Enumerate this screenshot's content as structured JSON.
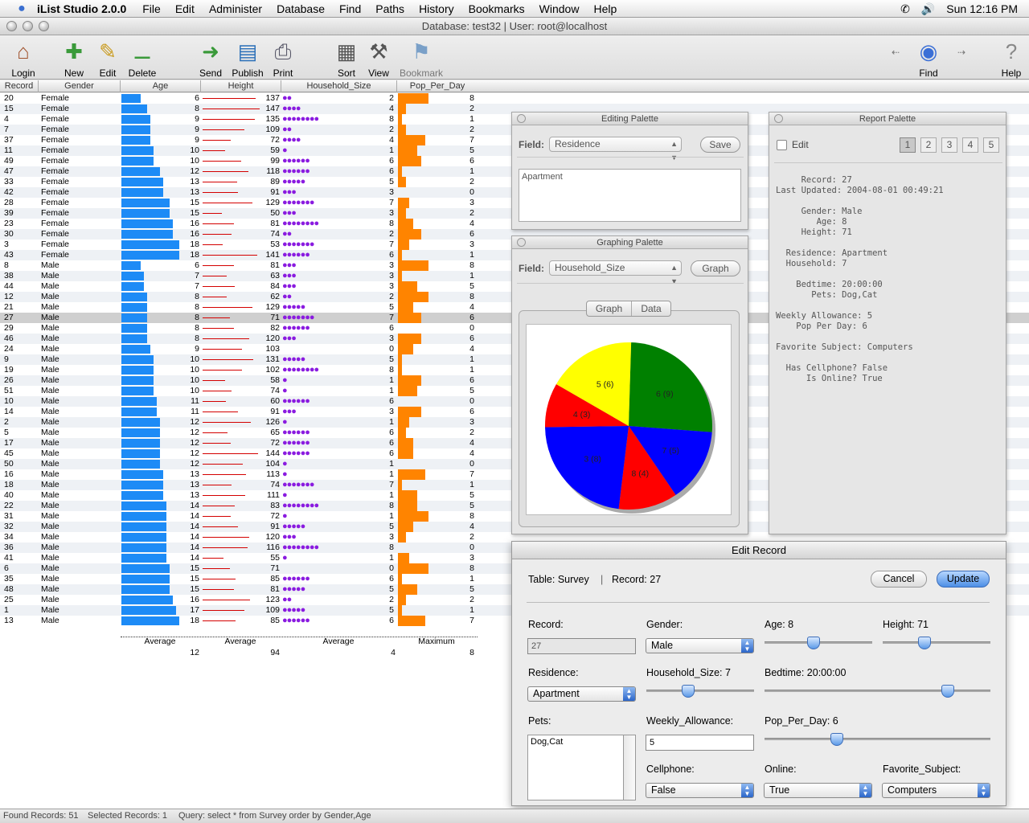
{
  "menubar": {
    "app": "iList Studio 2.0.0",
    "items": [
      "File",
      "Edit",
      "Administer",
      "Database",
      "Find",
      "Paths",
      "History",
      "Bookmarks",
      "Window",
      "Help"
    ],
    "clock": "Sun 12:16 PM"
  },
  "window": {
    "title": "Database: test32 | User: root@localhost"
  },
  "toolbar": {
    "login": "Login",
    "new": "New",
    "edit": "Edit",
    "delete": "Delete",
    "send": "Send",
    "publish": "Publish",
    "print": "Print",
    "sort": "Sort",
    "view": "View",
    "bookmark": "Bookmark",
    "find": "Find",
    "help": "Help"
  },
  "columns": [
    "Record",
    "Gender",
    "Age",
    "Height",
    "Household_Size",
    "Pop_Per_Day"
  ],
  "records": [
    [
      20,
      "Female",
      6,
      137,
      2,
      8
    ],
    [
      15,
      "Female",
      8,
      147,
      4,
      2
    ],
    [
      4,
      "Female",
      9,
      135,
      8,
      1
    ],
    [
      7,
      "Female",
      9,
      109,
      2,
      2
    ],
    [
      37,
      "Female",
      9,
      72,
      4,
      7
    ],
    [
      11,
      "Female",
      10,
      59,
      1,
      5
    ],
    [
      49,
      "Female",
      10,
      99,
      6,
      6
    ],
    [
      47,
      "Female",
      12,
      118,
      6,
      1
    ],
    [
      33,
      "Female",
      13,
      89,
      5,
      2
    ],
    [
      42,
      "Female",
      13,
      91,
      3,
      0
    ],
    [
      28,
      "Female",
      15,
      129,
      7,
      3
    ],
    [
      39,
      "Female",
      15,
      50,
      3,
      2
    ],
    [
      23,
      "Female",
      16,
      81,
      8,
      4
    ],
    [
      30,
      "Female",
      16,
      74,
      2,
      6
    ],
    [
      3,
      "Female",
      18,
      53,
      7,
      3
    ],
    [
      43,
      "Female",
      18,
      141,
      6,
      1
    ],
    [
      8,
      "Male",
      6,
      81,
      3,
      8
    ],
    [
      38,
      "Male",
      7,
      63,
      3,
      1
    ],
    [
      44,
      "Male",
      7,
      84,
      3,
      5
    ],
    [
      12,
      "Male",
      8,
      62,
      2,
      8
    ],
    [
      21,
      "Male",
      8,
      129,
      5,
      4
    ],
    [
      27,
      "Male",
      8,
      71,
      7,
      6
    ],
    [
      29,
      "Male",
      8,
      82,
      6,
      0
    ],
    [
      46,
      "Male",
      8,
      120,
      3,
      6
    ],
    [
      24,
      "Male",
      9,
      103,
      0,
      4
    ],
    [
      9,
      "Male",
      10,
      131,
      5,
      1
    ],
    [
      19,
      "Male",
      10,
      102,
      8,
      1
    ],
    [
      26,
      "Male",
      10,
      58,
      1,
      6
    ],
    [
      51,
      "Male",
      10,
      74,
      1,
      5
    ],
    [
      10,
      "Male",
      11,
      60,
      6,
      0
    ],
    [
      14,
      "Male",
      11,
      91,
      3,
      6
    ],
    [
      2,
      "Male",
      12,
      126,
      1,
      3
    ],
    [
      5,
      "Male",
      12,
      65,
      6,
      2
    ],
    [
      17,
      "Male",
      12,
      72,
      6,
      4
    ],
    [
      45,
      "Male",
      12,
      144,
      6,
      4
    ],
    [
      50,
      "Male",
      12,
      104,
      1,
      0
    ],
    [
      16,
      "Male",
      13,
      113,
      1,
      7
    ],
    [
      18,
      "Male",
      13,
      74,
      7,
      1
    ],
    [
      40,
      "Male",
      13,
      111,
      1,
      5
    ],
    [
      22,
      "Male",
      14,
      83,
      8,
      5
    ],
    [
      31,
      "Male",
      14,
      72,
      1,
      8
    ],
    [
      32,
      "Male",
      14,
      91,
      5,
      4
    ],
    [
      34,
      "Male",
      14,
      120,
      3,
      2
    ],
    [
      36,
      "Male",
      14,
      116,
      8,
      0
    ],
    [
      41,
      "Male",
      14,
      55,
      1,
      3
    ],
    [
      6,
      "Male",
      15,
      71,
      0,
      8
    ],
    [
      35,
      "Male",
      15,
      85,
      6,
      1
    ],
    [
      48,
      "Male",
      15,
      81,
      5,
      5
    ],
    [
      25,
      "Male",
      16,
      123,
      2,
      2
    ],
    [
      1,
      "Male",
      17,
      109,
      5,
      1
    ],
    [
      13,
      "Male",
      18,
      85,
      6,
      7
    ]
  ],
  "selected_record": 27,
  "summary": {
    "age_label": "Average",
    "age_value": "12",
    "height_label": "Average",
    "height_value": "94",
    "household_label": "Average",
    "household_value": "4",
    "pop_label": "Maximum",
    "pop_value": "8"
  },
  "status": {
    "found": "Found Records: 51",
    "selected": "Selected Records: 1",
    "query": "Query: select * from Survey order by Gender,Age"
  },
  "editing_palette": {
    "title": "Editing Palette",
    "field_label": "Field:",
    "field_value": "Residence",
    "save": "Save",
    "text": "Apartment"
  },
  "graphing_palette": {
    "title": "Graphing Palette",
    "field_label": "Field:",
    "field_value": "Household_Size",
    "graph_button": "Graph",
    "tab_graph": "Graph",
    "tab_data": "Data"
  },
  "chart_data": {
    "type": "pie",
    "labels": [
      "6 (9)",
      "7 (5)",
      "8 (4)",
      "3 (8)",
      "4 (3)",
      "5 (6)"
    ],
    "values": [
      9,
      5,
      4,
      8,
      3,
      6
    ],
    "colors": [
      "#008000",
      "#0000ff",
      "#ff0000",
      "#0000ff",
      "#ff0000",
      "#ffff00"
    ]
  },
  "report_palette": {
    "title": "Report Palette",
    "edit_label": "Edit",
    "pages": [
      "1",
      "2",
      "3",
      "4",
      "5"
    ],
    "lines": [
      "     Record: 27",
      "Last Updated: 2004-08-01 00:49:21",
      "",
      "     Gender: Male",
      "        Age: 8",
      "     Height: 71",
      "",
      "  Residence: Apartment",
      "  Household: 7",
      "",
      "    Bedtime: 20:00:00",
      "       Pets: Dog,Cat",
      "",
      "Weekly Allowance: 5",
      "    Pop Per Day: 6",
      "",
      "Favorite Subject: Computers",
      "",
      "  Has Cellphone? False",
      "      Is Online? True"
    ]
  },
  "edit_record": {
    "title": "Edit Record",
    "table": "Table: Survey",
    "record_hdr": "Record: 27",
    "cancel": "Cancel",
    "update": "Update",
    "record_label": "Record:",
    "record_value": "27",
    "gender_label": "Gender:",
    "gender_value": "Male",
    "age_label": "Age: 8",
    "height_label": "Height: 71",
    "residence_label": "Residence:",
    "residence_value": "Apartment",
    "household_label": "Household_Size: 7",
    "bedtime_label": "Bedtime: 20:00:00",
    "pets_label": "Pets:",
    "pets_value": "Dog,Cat",
    "allowance_label": "Weekly_Allowance:",
    "allowance_value": "5",
    "pop_label": "Pop_Per_Day: 6",
    "cellphone_label": "Cellphone:",
    "cellphone_value": "False",
    "online_label": "Online:",
    "online_value": "True",
    "subject_label": "Favorite_Subject:",
    "subject_value": "Computers",
    "sliders": {
      "age": 0.45,
      "height": 0.37,
      "household": 0.37,
      "bedtime": 0.83,
      "pop": 0.31
    }
  }
}
